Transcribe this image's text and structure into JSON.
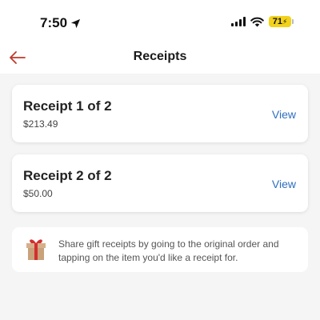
{
  "status_bar": {
    "time": "7:50",
    "battery_level": "71",
    "icons": [
      "location-arrow-icon",
      "cellular-signal-icon",
      "wifi-icon",
      "battery-icon"
    ]
  },
  "header": {
    "title": "Receipts",
    "back_icon": "arrow-left-icon",
    "accent_color": "#c0392b"
  },
  "receipts": [
    {
      "title": "Receipt 1 of 2",
      "amount": "$213.49",
      "action": "View"
    },
    {
      "title": "Receipt 2 of 2",
      "amount": "$50.00",
      "action": "View"
    }
  ],
  "gift_info": {
    "icon": "gift-icon",
    "text": "Share gift receipts by going to the original order and tapping on the item you'd like a receipt for."
  },
  "colors": {
    "link": "#2e6ec0",
    "background": "#f5f5f5",
    "battery": "#f2d21b"
  }
}
